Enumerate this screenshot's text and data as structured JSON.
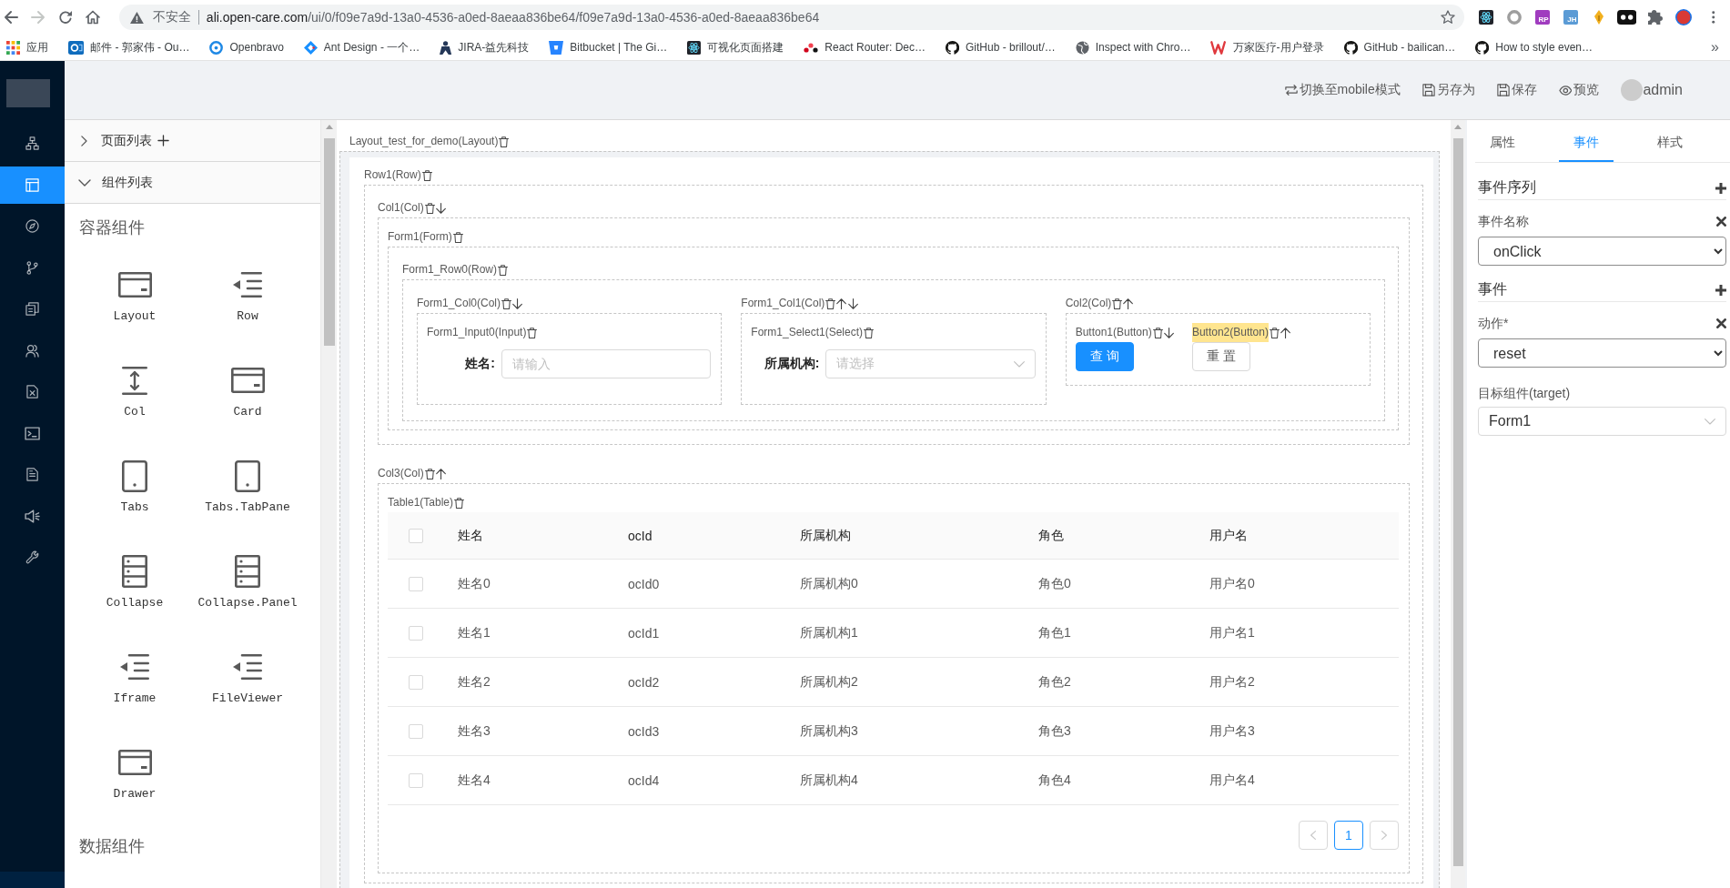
{
  "browser": {
    "navigation": {
      "back": {
        "disabled": false
      },
      "forward": {
        "disabled": true
      }
    },
    "address": {
      "security": "不安全",
      "domain": "ali.open-care.com",
      "path": "/ui/0/f09e7a9d-13a0-4536-a0ed-8aeaa836be64/f09e7a9d-13a0-4536-a0ed-8aeaa836be64"
    },
    "extensions": [
      {
        "kind": "icon"
      },
      {
        "kind": "icon"
      },
      {
        "kind": "badge",
        "label": "RP",
        "color": "#a03cbf"
      },
      {
        "kind": "badge",
        "label": "JH",
        "color": "#5b9bd5"
      },
      {
        "kind": "icon"
      },
      {
        "kind": "icon"
      },
      {
        "kind": "icon"
      }
    ],
    "bookmarks": [
      {
        "label": "应用"
      },
      {
        "label": "邮件 - 郭家伟 - Ou…"
      },
      {
        "label": "Openbravo"
      },
      {
        "label": "Ant Design - 一个…"
      },
      {
        "label": "JIRA-益先科技"
      },
      {
        "label": "Bitbucket | The Gi…"
      },
      {
        "label": "可视化页面搭建"
      },
      {
        "label": "React Router: Dec…"
      },
      {
        "label": "GitHub - brillout/…"
      },
      {
        "label": "Inspect with Chro…"
      },
      {
        "label": "万家医疗-用户登录"
      },
      {
        "label": "GitHub - bailican…"
      },
      {
        "label": "How to style even…"
      }
    ],
    "more": "»"
  },
  "sidebar": {
    "items": [
      {
        "selected": false
      },
      {
        "selected": true
      },
      {
        "selected": false
      },
      {
        "selected": false
      },
      {
        "selected": false
      },
      {
        "selected": false
      },
      {
        "selected": false
      },
      {
        "selected": false
      },
      {
        "selected": false
      },
      {
        "selected": false
      },
      {
        "selected": false
      }
    ]
  },
  "header": {
    "actions": [
      {
        "label": "切换至mobile模式"
      },
      {
        "label": "另存为"
      },
      {
        "label": "保存"
      },
      {
        "label": "预览"
      }
    ],
    "user": "admin"
  },
  "component_panel": {
    "sections": [
      {
        "label": "页面列表",
        "expanded": false,
        "add_button": true
      },
      {
        "label": "组件列表",
        "expanded": true,
        "add_button": false
      }
    ],
    "groups": [
      {
        "title": "容器组件",
        "components": [
          {
            "label": "Layout"
          },
          {
            "label": "Row"
          },
          {
            "label": "Col"
          },
          {
            "label": "Card"
          },
          {
            "label": "Tabs"
          },
          {
            "label": "Tabs.TabPane"
          },
          {
            "label": "Collapse"
          },
          {
            "label": "Collapse.Panel"
          },
          {
            "label": "Iframe"
          },
          {
            "label": "FileViewer"
          },
          {
            "label": "Drawer"
          }
        ]
      },
      {
        "title": "数据组件"
      }
    ]
  },
  "canvas": {
    "root": {
      "kind": "layout",
      "label": "Layout_test_for_demo(Layout)",
      "selected": false,
      "move_up": false,
      "move_down": false,
      "children": [
        {
          "kind": "row",
          "label": "Row1(Row)",
          "selected": false,
          "move_up": false,
          "move_down": false,
          "children": [
            {
              "kind": "col",
              "label": "Col1(Col)",
              "selected": false,
              "move_up": false,
              "move_down": true,
              "children": [
                {
                  "kind": "form",
                  "label": "Form1(Form)",
                  "selected": false,
                  "move_up": false,
                  "move_down": false,
                  "children": [
                    {
                      "kind": "row",
                      "label": "Form1_Row0(Row)",
                      "selected": false,
                      "move_up": false,
                      "move_down": false,
                      "children": [
                        {
                          "kind": "col",
                          "label": "Form1_Col0(Col)",
                          "selected": false,
                          "move_up": false,
                          "move_down": true,
                          "children": [
                            {
                              "kind": "input",
                              "label": "Form1_Input0(Input)",
                              "selected": false,
                              "move_up": false,
                              "move_down": false,
                              "field_label": "姓名:",
                              "placeholder": "请输入"
                            }
                          ]
                        },
                        {
                          "kind": "col",
                          "label": "Form1_Col1(Col)",
                          "selected": false,
                          "move_up": true,
                          "move_down": true,
                          "children": [
                            {
                              "kind": "select",
                              "label": "Form1_Select1(Select)",
                              "selected": false,
                              "move_up": false,
                              "move_down": false,
                              "field_label": "所属机构:",
                              "placeholder": "请选择"
                            }
                          ]
                        },
                        {
                          "kind": "col",
                          "label": "Col2(Col)",
                          "selected": false,
                          "move_up": true,
                          "move_down": false,
                          "children": [
                            {
                              "kind": "button",
                              "label": "Button1(Button)",
                              "selected": false,
                              "move_up": false,
                              "move_down": true,
                              "text": "查 询",
                              "primary": true
                            },
                            {
                              "kind": "button",
                              "label": "Button2(Button)",
                              "selected": true,
                              "move_up": true,
                              "move_down": false,
                              "text": "重 置",
                              "primary": false
                            }
                          ]
                        }
                      ]
                    }
                  ]
                }
              ]
            },
            {
              "kind": "col",
              "label": "Col3(Col)",
              "selected": false,
              "move_up": true,
              "move_down": false,
              "children": [
                {
                  "kind": "table",
                  "label": "Table1(Table)",
                  "selected": false,
                  "move_up": false,
                  "move_down": false,
                  "all_checked": false,
                  "columns": [
                    "姓名",
                    "ocId",
                    "所属机构",
                    "角色",
                    "用户名"
                  ],
                  "rows": [
                    {
                      "checked": false,
                      "cells": [
                        "姓名0",
                        "ocId0",
                        "所属机构0",
                        "角色0",
                        "用户名0"
                      ]
                    },
                    {
                      "checked": false,
                      "cells": [
                        "姓名1",
                        "ocId1",
                        "所属机构1",
                        "角色1",
                        "用户名1"
                      ]
                    },
                    {
                      "checked": false,
                      "cells": [
                        "姓名2",
                        "ocId2",
                        "所属机构2",
                        "角色2",
                        "用户名2"
                      ]
                    },
                    {
                      "checked": false,
                      "cells": [
                        "姓名3",
                        "ocId3",
                        "所属机构3",
                        "角色3",
                        "用户名3"
                      ]
                    },
                    {
                      "checked": false,
                      "cells": [
                        "姓名4",
                        "ocId4",
                        "所属机构4",
                        "角色4",
                        "用户名4"
                      ]
                    }
                  ],
                  "pagination": {
                    "prev_disabled": true,
                    "next_disabled": true,
                    "pages": [
                      {
                        "label": "1",
                        "selected": true
                      }
                    ]
                  }
                }
              ]
            }
          ]
        }
      ]
    }
  },
  "properties_panel": {
    "tabs": [
      {
        "label": "属性",
        "selected": false
      },
      {
        "label": "事件",
        "selected": true
      },
      {
        "label": "样式",
        "selected": false
      }
    ],
    "items": [
      {
        "kind": "section",
        "title": "事件序列"
      },
      {
        "kind": "native-select",
        "label": "事件名称",
        "value": "onClick",
        "removable": true
      },
      {
        "kind": "section",
        "title": "事件"
      },
      {
        "kind": "native-select",
        "label": "动作*",
        "value": "reset",
        "removable": true
      },
      {
        "kind": "select",
        "label": "目标组件(target)",
        "value": "Form1",
        "removable": false
      }
    ]
  }
}
